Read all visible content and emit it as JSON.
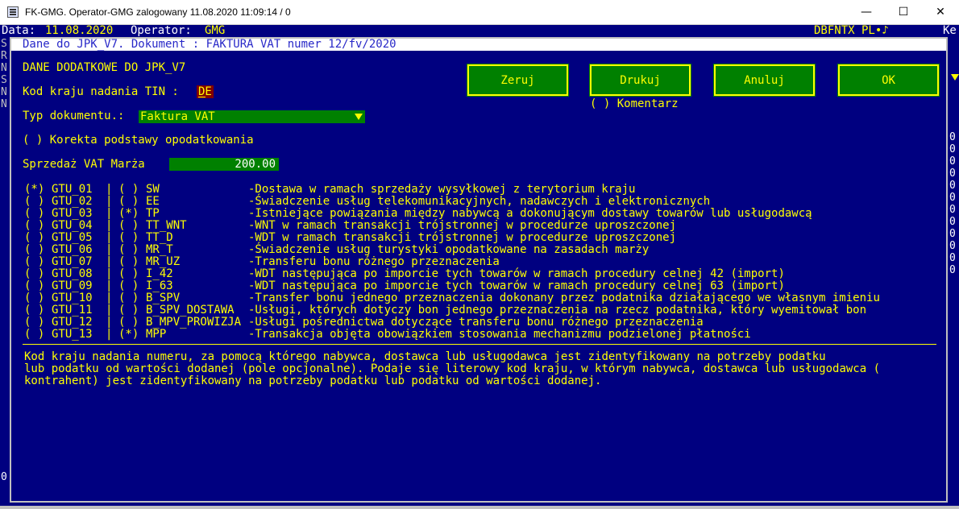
{
  "window": {
    "title": "FK-GMG. Operator-GMG zalogowany 11.08.2020 11:09:14 / 0",
    "minimize_glyph": "—",
    "maximize_glyph": "☐",
    "close_glyph": "✕"
  },
  "status": {
    "data_label": "Data:",
    "data_value": "11.08.2020",
    "operator_label": "Operator:",
    "operator_value": "GMG",
    "right_info": "DBFNTX PL•♪",
    "right_fragment": "Ke"
  },
  "left_column": [
    "S",
    "R",
    "N",
    "S",
    "N",
    "N"
  ],
  "right_column": [
    "0",
    "0",
    "0",
    "0",
    "0",
    "0",
    "0",
    "0",
    "0",
    "0",
    "0",
    "0"
  ],
  "bottom_left": "0",
  "dialog": {
    "title": "Dane do JPK_V7. Dokument : FAKTURA VAT numer 12/fv/2020",
    "heading": "DANE DODATKOWE DO JPK_V7",
    "tin_label": "Kod kraju nadania TIN :",
    "tin_value": "DE",
    "doc_type_label": "Typ dokumentu.:",
    "doc_type_value": "Faktura VAT",
    "korekta_label": "( ) Korekta podstawy opodatkowania",
    "sprzedaz_label": "Sprzedaż VAT Marża",
    "sprzedaz_value": "200.00",
    "buttons": {
      "zeruj": "Zeruj",
      "drukuj": "Drukuj",
      "anuluj": "Anuluj",
      "ok": "OK"
    },
    "komentarz_label": "( ) Komentarz"
  },
  "gtu_rows": [
    {
      "gtu_check": "(*)",
      "gtu": "GTU_01",
      "code_check": "( )",
      "code": "SW",
      "desc": "-Dostawa w ramach sprzedaży wysyłkowej z terytorium kraju"
    },
    {
      "gtu_check": "( )",
      "gtu": "GTU_02",
      "code_check": "( )",
      "code": "EE",
      "desc": "-Świadczenie usług telekomunikacyjnych, nadawczych i elektronicznych"
    },
    {
      "gtu_check": "( )",
      "gtu": "GTU_03",
      "code_check": "(*)",
      "code": "TP",
      "desc": "-Istniejące powiązania między nabywcą a dokonującym dostawy towarów lub usługodawcą"
    },
    {
      "gtu_check": "( )",
      "gtu": "GTU_04",
      "code_check": "( )",
      "code": "TT_WNT",
      "desc": "-WNT w ramach transakcji trójstronnej w procedurze uproszczonej"
    },
    {
      "gtu_check": "( )",
      "gtu": "GTU_05",
      "code_check": "( )",
      "code": "TT_D",
      "desc": "-WDT w ramach transakcji trójstronnej w procedurze uproszczonej"
    },
    {
      "gtu_check": "( )",
      "gtu": "GTU_06",
      "code_check": "( )",
      "code": "MR_T",
      "desc": "-Świadczenie usług turystyki opodatkowane na zasadach marży"
    },
    {
      "gtu_check": "( )",
      "gtu": "GTU_07",
      "code_check": "( )",
      "code": "MR_UZ",
      "desc": "-Transferu bonu różnego przeznaczenia"
    },
    {
      "gtu_check": "( )",
      "gtu": "GTU_08",
      "code_check": "( )",
      "code": "I_42",
      "desc": "-WDT następująca po imporcie tych towarów w ramach procedury celnej 42 (import)"
    },
    {
      "gtu_check": "( )",
      "gtu": "GTU_09",
      "code_check": "( )",
      "code": "I_63",
      "desc": "-WDT następująca po imporcie tych towarów w ramach procedury celnej 63 (import)"
    },
    {
      "gtu_check": "( )",
      "gtu": "GTU_10",
      "code_check": "( )",
      "code": "B_SPV",
      "desc": "-Transfer bonu jednego przeznaczenia dokonany przez podatnika działającego we własnym imieniu"
    },
    {
      "gtu_check": "( )",
      "gtu": "GTU_11",
      "code_check": "( )",
      "code": "B_SPV_DOSTAWA",
      "desc": "-Usługi, których dotyczy bon jednego przeznaczenia na rzecz podatnika, który wyemitował bon"
    },
    {
      "gtu_check": "( )",
      "gtu": "GTU_12",
      "code_check": "( )",
      "code": "B_MPV_PROWIZJA",
      "desc": "-Usługi pośrednictwa dotyczące transferu bonu różnego przeznaczenia"
    },
    {
      "gtu_check": "( )",
      "gtu": "GTU_13",
      "code_check": "(*)",
      "code": "MPP",
      "desc": "-Transakcja objęta obowiązkiem stosowania mechanizmu podzielonej płatności"
    }
  ],
  "help_text": [
    "Kod kraju nadania numeru, za pomocą którego nabywca, dostawca lub usługodawca jest zidentyfikowany na potrzeby podatku",
    "lub podatku od wartości dodanej (pole opcjonalne). Podaje się literowy kod kraju, w którym nabywca, dostawca lub usługodawca (",
    "kontrahent) jest zidentyfikowany na potrzeby podatku lub podatku od wartości dodanej."
  ],
  "colors": {
    "background": "#000080",
    "text": "#ffff00",
    "field": "#008000",
    "tin_field": "#800000"
  }
}
